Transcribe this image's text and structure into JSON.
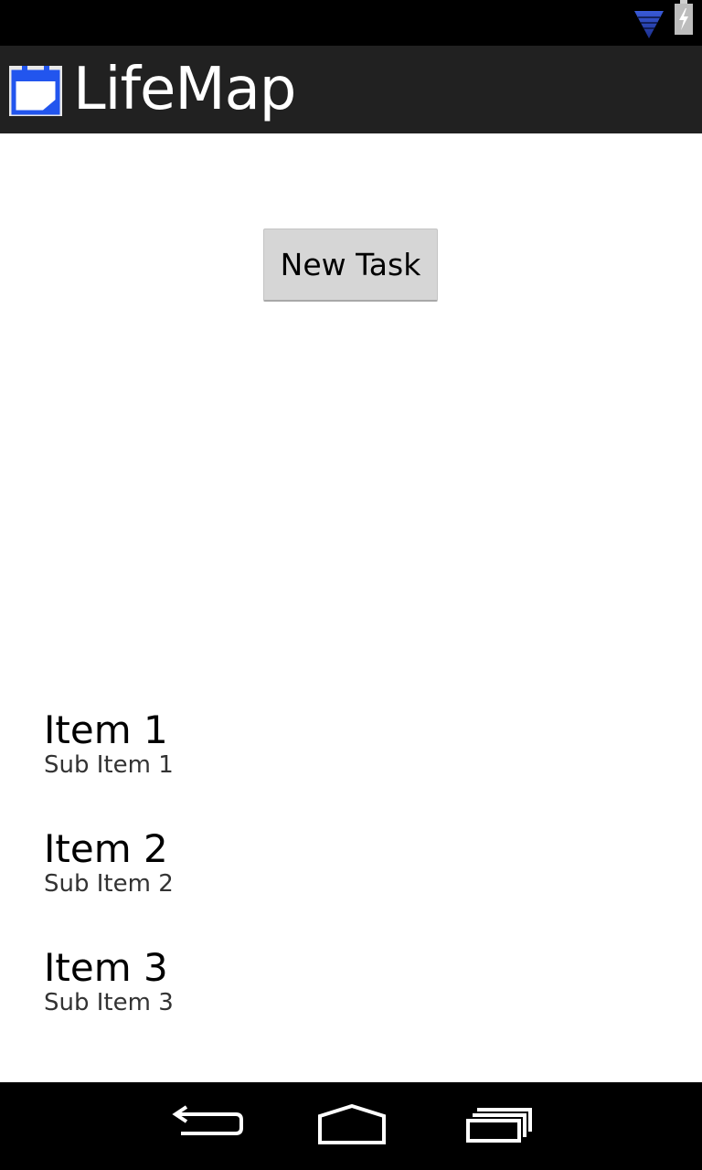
{
  "status_bar": {
    "icons": [
      "wifi-icon",
      "battery-charging-icon"
    ]
  },
  "action_bar": {
    "app_icon": "calendar-icon",
    "title": "LifeMap"
  },
  "main": {
    "new_task_label": "New Task",
    "items": [
      {
        "title": "Item 1",
        "subtitle": "Sub Item 1"
      },
      {
        "title": "Item 2",
        "subtitle": "Sub Item 2"
      },
      {
        "title": "Item 3",
        "subtitle": "Sub Item 3"
      }
    ]
  },
  "nav_bar": {
    "icons": [
      "back-icon",
      "home-icon",
      "recent-apps-icon"
    ]
  },
  "colors": {
    "action_bar": "#212121",
    "status_bar": "#000000",
    "accent": "#2255ee",
    "button": "#d6d6d6"
  }
}
